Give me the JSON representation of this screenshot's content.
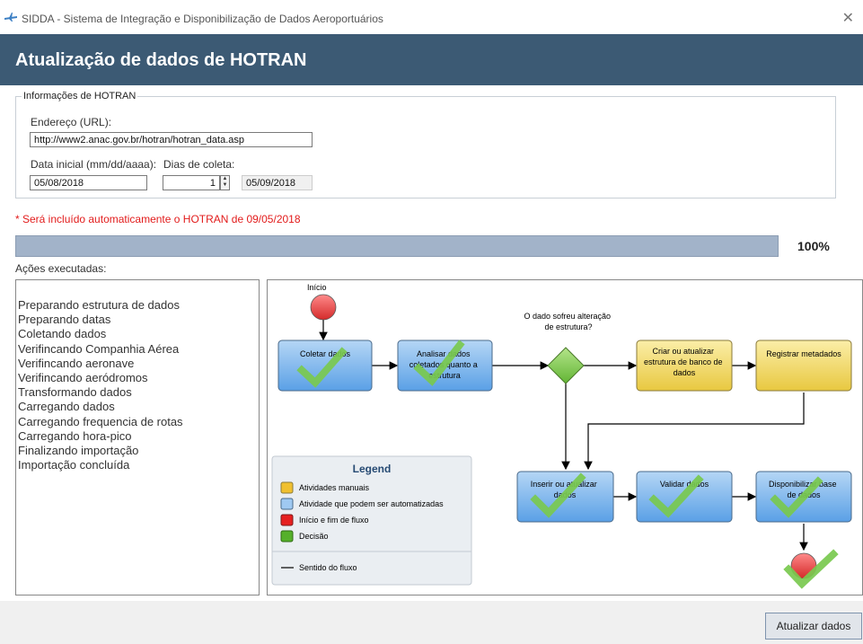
{
  "window": {
    "title": "SIDDA - Sistema de Integração e Disponibilização de Dados Aeroportuários",
    "close_glyph": "✕"
  },
  "header": {
    "title": "Atualização de dados de HOTRAN"
  },
  "group": {
    "legend": "Informações de HOTRAN",
    "url_label": "Endereço (URL):",
    "url_value": "http://www2.anac.gov.br/hotran/hotran_data.asp",
    "start_label": "Data inicial (mm/dd/aaaa):",
    "start_value": "05/08/2018",
    "days_label": "Dias de coleta:",
    "days_value": "1",
    "end_value": "05/09/2018"
  },
  "warning": "* Será incluído automaticamente o HOTRAN de 09/05/2018",
  "progress": {
    "value": 100,
    "label": "100%"
  },
  "actions": {
    "label": "Ações executadas:",
    "items": [
      "Preparando estrutura de dados",
      "Preparando datas",
      "Coletando dados",
      "Verifincando Companhia Aérea",
      "Verifincando aeronave",
      "Verifincando aeródromos",
      "Transformando dados",
      "Carregando dados",
      "Carregando frequencia de rotas",
      "Carregando hora-pico",
      "Finalizando importação",
      "Importação concluída"
    ]
  },
  "flow": {
    "start": "Início",
    "collect": "Coletar dados",
    "analyze": [
      "Analisar dados",
      "coletados quanto a",
      "estrutura"
    ],
    "decision": [
      "O dado sofreu alteração",
      "de estrutura?"
    ],
    "create": [
      "Criar ou atualizar",
      "estrutura de banco de",
      "dados"
    ],
    "register": "Registrar metadados",
    "insert": [
      "Inserir ou atualizar",
      "dados"
    ],
    "validate": "Validar dados",
    "publish": [
      "Disponibilizar base",
      "de dados"
    ],
    "legend": {
      "title": "Legend",
      "manual": "Atividades manuais",
      "automated": "Atividade que podem ser automatizadas",
      "startend": "Início e fim de fluxo",
      "decision": "Decisão",
      "direction": "Sentido do fluxo"
    }
  },
  "colors": {
    "header": "#3c5a74",
    "blue_box": "#7fb6ec",
    "yellow_box": "#f0d868",
    "red": "#e84545",
    "green": "#7bc84a",
    "check": "#79c94f",
    "warning": "#e21b1b"
  },
  "footer": {
    "update_button": "Atualizar dados"
  }
}
